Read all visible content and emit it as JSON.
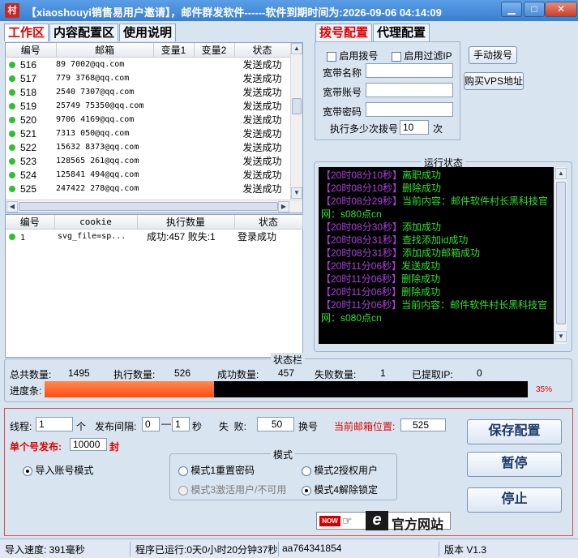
{
  "window": {
    "title": "【xiaoshouyi销售易用户邀请】，邮件群发软件------软件到期时间为:2026-09-06 04:14:09",
    "icon_char": "村",
    "min_label": "▁",
    "max_label": "□",
    "close_label": "✕"
  },
  "left_tabs": [
    "工作区",
    "内容配置区",
    "使用说明"
  ],
  "email_table": {
    "headers": [
      "编号",
      "邮箱",
      "变量1",
      "变量2",
      "状态"
    ],
    "rows": [
      {
        "id": "516",
        "email": "89  7002@qq.com",
        "status": "发送成功"
      },
      {
        "id": "517",
        "email": "779  3768@qq.com",
        "status": "发送成功"
      },
      {
        "id": "518",
        "email": "2540  7307@qq.com",
        "status": "发送成功"
      },
      {
        "id": "519",
        "email": "25749  75350@qq.com",
        "status": "发送成功"
      },
      {
        "id": "520",
        "email": "9706  4169@qq.com",
        "status": "发送成功"
      },
      {
        "id": "521",
        "email": "7313  050@qq.com",
        "status": "发送成功"
      },
      {
        "id": "522",
        "email": "15632  8373@qq.com",
        "status": "发送成功"
      },
      {
        "id": "523",
        "email": "128565  261@qq.com",
        "status": "发送成功"
      },
      {
        "id": "524",
        "email": "125841  494@qq.com",
        "status": "发送成功"
      },
      {
        "id": "525",
        "email": "247422  278@qq.com",
        "status": "发送成功"
      }
    ]
  },
  "cookie_table": {
    "headers": [
      "编号",
      "cookie",
      "执行数量",
      "状态"
    ],
    "rows": [
      {
        "id": "1",
        "cookie": "svg_file=sp...",
        "count": "成功:457 败失:1",
        "status": "登录成功"
      }
    ]
  },
  "right_tabs": [
    "拨号配置",
    "代理配置"
  ],
  "dial": {
    "enable_dial": "启用拨号",
    "enable_filter_ip": "启用过滤IP",
    "manual_dial_button": "手动拨号",
    "buy_vps_button": "购买VPS地址",
    "broadband_name_label": "宽带名称",
    "broadband_account_label": "宽带账号",
    "broadband_password_label": "宽带密码",
    "dial_every_prefix": "执行多少次拨号",
    "dial_every_value": "10",
    "dial_every_suffix": "次"
  },
  "run_status": {
    "title": "运行状态",
    "lines": [
      {
        "time": "【20时08分10秒】",
        "msg": "离职成功"
      },
      {
        "time": "【20时08分10秒】",
        "msg": "删除成功"
      },
      {
        "time": "【20时08分29秒】",
        "msg": "当前内容：邮件软件村长黑科技官"
      },
      {
        "time": "",
        "msg": "网：s080点cn"
      },
      {
        "time": "【20时08分30秒】",
        "msg": "添加成功"
      },
      {
        "time": "【20时08分31秒】",
        "msg": "查找添加id成功"
      },
      {
        "time": "【20时08分31秒】",
        "msg": "添加成功邮箱成功"
      },
      {
        "time": "【20时11分06秒】",
        "msg": "发送成功"
      },
      {
        "time": "【20时11分06秒】",
        "msg": "删除成功"
      },
      {
        "time": "【20时11分06秒】",
        "msg": "删除成功"
      },
      {
        "time": "【20时11分06秒】",
        "msg": "当前内容：邮件软件村长黑科技官"
      },
      {
        "time": "",
        "msg": "网：s080点cn"
      }
    ]
  },
  "status_panel": {
    "title": "状态栏",
    "total_label": "总共数量:",
    "total_value": "1495",
    "exec_label": "执行数量:",
    "exec_value": "526",
    "success_label": "成功数量:",
    "success_value": "457",
    "fail_label": "失败数量:",
    "fail_value": "1",
    "ip_label": "已提取IP:",
    "ip_value": "0",
    "progress_label": "进度条:",
    "progress_percent": 35,
    "progress_text": "35%"
  },
  "settings": {
    "thread_label": "线程:",
    "thread_value": "1",
    "thread_unit": "个",
    "interval_label": "发布间隔:",
    "interval_min": "0",
    "interval_sep": "—",
    "interval_max": "1",
    "interval_unit": "秒",
    "fail_label": "失  败:",
    "fail_value": "50",
    "fail_unit": "换号",
    "current_pos_label": "当前邮箱位置:",
    "current_pos_value": "525",
    "single_publish_label": "单个号发布:",
    "single_publish_value": "10000",
    "single_publish_unit": "封",
    "import_mode_label": "导入账号模式",
    "mode_title": "模式",
    "mode1": "模式1重置密码",
    "mode2": "模式2授权用户",
    "mode3": "模式3激活用户/不可用",
    "mode4": "模式4解除锁定",
    "save_button": "保存配置",
    "pause_button": "暂停",
    "stop_button": "停止",
    "banner_now": "NOW",
    "banner_e": "e",
    "banner_text": "官方网站"
  },
  "statusbar": {
    "import_speed": "导入速度: 391毫秒",
    "runtime": "程序已运行:0天0小时20分钟37秒",
    "account": "aa764341854",
    "version": "版本 V1.3"
  },
  "colors": {
    "title_bar": "#3a7fd0",
    "progress_fill": "#ff5a20",
    "progress_track": "#000000",
    "accent_red": "#e00000",
    "log_time": "#b040e0",
    "log_msg": "#30e030"
  }
}
